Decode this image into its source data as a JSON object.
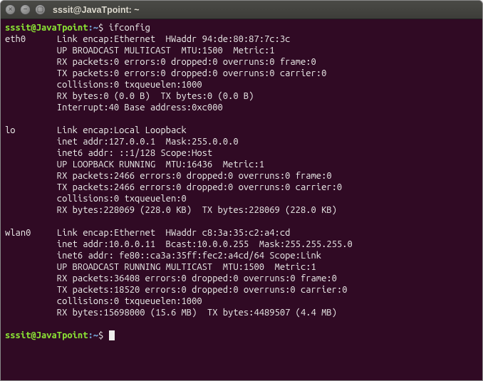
{
  "window": {
    "title": "sssit@JavaTpoint: ~"
  },
  "prompt": {
    "user_host": "sssit@JavaTpoint",
    "path": "~",
    "sep1": ":",
    "sep2": "$ "
  },
  "command": "ifconfig",
  "output": "eth0      Link encap:Ethernet  HWaddr 94:de:80:87:7c:3c\n          UP BROADCAST MULTICAST  MTU:1500  Metric:1\n          RX packets:0 errors:0 dropped:0 overruns:0 frame:0\n          TX packets:0 errors:0 dropped:0 overruns:0 carrier:0\n          collisions:0 txqueuelen:1000\n          RX bytes:0 (0.0 B)  TX bytes:0 (0.0 B)\n          Interrupt:40 Base address:0xc000\n\nlo        Link encap:Local Loopback\n          inet addr:127.0.0.1  Mask:255.0.0.0\n          inet6 addr: ::1/128 Scope:Host\n          UP LOOPBACK RUNNING  MTU:16436  Metric:1\n          RX packets:2466 errors:0 dropped:0 overruns:0 frame:0\n          TX packets:2466 errors:0 dropped:0 overruns:0 carrier:0\n          collisions:0 txqueuelen:0\n          RX bytes:228069 (228.0 KB)  TX bytes:228069 (228.0 KB)\n\nwlan0     Link encap:Ethernet  HWaddr c8:3a:35:c2:a4:cd\n          inet addr:10.0.0.11  Bcast:10.0.0.255  Mask:255.255.255.0\n          inet6 addr: fe80::ca3a:35ff:fec2:a4cd/64 Scope:Link\n          UP BROADCAST RUNNING MULTICAST  MTU:1500  Metric:1\n          RX packets:36408 errors:0 dropped:0 overruns:0 frame:0\n          TX packets:18520 errors:0 dropped:0 overruns:0 carrier:0\n          collisions:0 txqueuelen:1000\n          RX bytes:15698000 (15.6 MB)  TX bytes:4489507 (4.4 MB)\n"
}
